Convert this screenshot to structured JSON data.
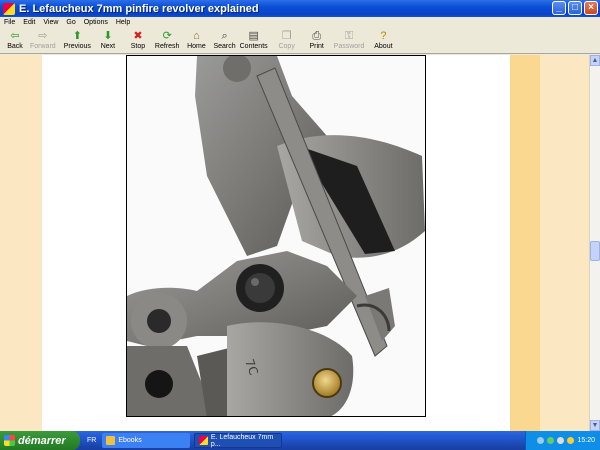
{
  "window": {
    "title": "E. Lefaucheux 7mm pinfire revolver explained",
    "buttons": {
      "minimize": "_",
      "maximize": "□",
      "close": "×"
    }
  },
  "menu": [
    "File",
    "Edit",
    "View",
    "Go",
    "Options",
    "Help"
  ],
  "toolbar": [
    {
      "label": "Back",
      "icon": "back-arrow-icon",
      "glyph": "⇦",
      "color": "#2a9a2a",
      "enabled": true
    },
    {
      "label": "Forward",
      "icon": "forward-arrow-icon",
      "glyph": "⇨",
      "color": "#a0a0a0",
      "enabled": false
    },
    {
      "label": "Previous",
      "icon": "up-arrow-icon",
      "glyph": "⬆",
      "color": "#2a9a2a",
      "enabled": true
    },
    {
      "label": "Next",
      "icon": "down-arrow-icon",
      "glyph": "⬇",
      "color": "#2a9a2a",
      "enabled": true
    },
    {
      "label": "Stop",
      "icon": "stop-icon",
      "glyph": "✖",
      "color": "#d02020",
      "enabled": true
    },
    {
      "label": "Refresh",
      "icon": "refresh-icon",
      "glyph": "⟳",
      "color": "#2a9a2a",
      "enabled": true
    },
    {
      "label": "Home",
      "icon": "home-icon",
      "glyph": "⌂",
      "color": "#8a6a2a",
      "enabled": true
    },
    {
      "label": "Search",
      "icon": "search-icon",
      "glyph": "⌕",
      "color": "#444",
      "enabled": true
    },
    {
      "label": "Contents",
      "icon": "contents-book-icon",
      "glyph": "▤",
      "color": "#444",
      "enabled": true
    },
    {
      "label": "Copy",
      "icon": "copy-icon",
      "glyph": "❐",
      "color": "#a0a0a0",
      "enabled": false
    },
    {
      "label": "Print",
      "icon": "printer-icon",
      "glyph": "⎙",
      "color": "#444",
      "enabled": true
    },
    {
      "label": "Password",
      "icon": "key-icon",
      "glyph": "⚿",
      "color": "#a0a0a0",
      "enabled": false
    },
    {
      "label": "About",
      "icon": "question-icon",
      "glyph": "?",
      "color": "#b08a00",
      "enabled": true
    }
  ],
  "content": {
    "image_subject": "E. Lefaucheux 7mm pinfire revolver mechanism close-up"
  },
  "taskbar": {
    "start_label": "démarrer",
    "language": "FR",
    "tasks": [
      {
        "label": "Ebooks",
        "active": false
      },
      {
        "label": "E. Lefaucheux 7mm p...",
        "active": true
      }
    ],
    "clock": "15:20"
  },
  "colors": {
    "left_margin": "#fbe8c3",
    "right_accent": "#fbd890",
    "titlebar": "#0a4fd6",
    "taskbar": "#245edb",
    "start_button": "#2f8a2f"
  }
}
